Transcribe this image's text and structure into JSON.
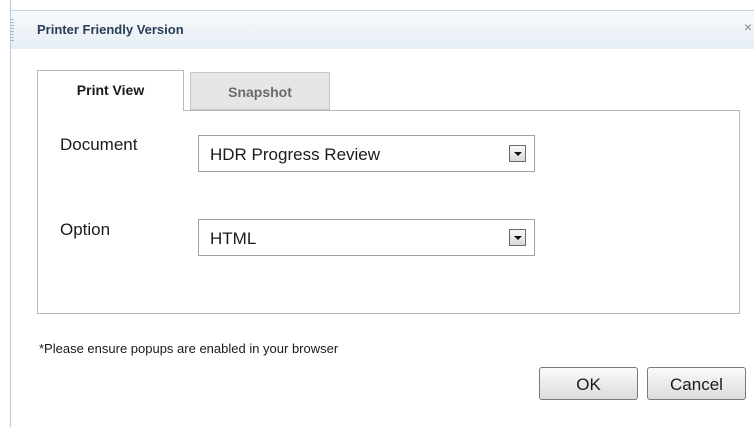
{
  "dialog": {
    "title": "Printer Friendly Version",
    "close_glyph": "×"
  },
  "tabs": [
    {
      "label": "Print View",
      "active": true
    },
    {
      "label": "Snapshot",
      "active": false
    }
  ],
  "form": {
    "document": {
      "label": "Document",
      "value": "HDR Progress Review"
    },
    "option": {
      "label": "Option",
      "value": "HTML"
    }
  },
  "note": "*Please ensure popups are enabled in your browser",
  "buttons": {
    "ok": "OK",
    "cancel": "Cancel"
  },
  "icons": {
    "close": "close-icon",
    "dropdown": "chevron-down-icon"
  }
}
